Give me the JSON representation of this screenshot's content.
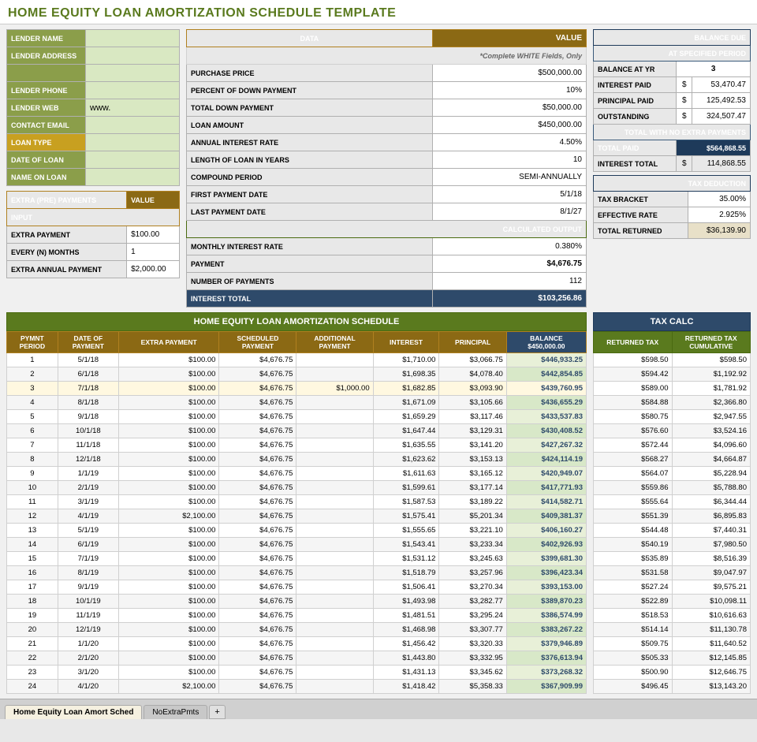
{
  "title": "HOME EQUITY LOAN AMORTIZATION SCHEDULE TEMPLATE",
  "lender": {
    "fields": [
      {
        "label": "LENDER NAME",
        "value": ""
      },
      {
        "label": "LENDER ADDRESS",
        "value": ""
      },
      {
        "label": "",
        "value": ""
      },
      {
        "label": "LENDER PHONE",
        "value": ""
      },
      {
        "label": "LENDER WEB",
        "value": "www."
      },
      {
        "label": "CONTACT EMAIL",
        "value": ""
      },
      {
        "label": "LOAN TYPE",
        "value": ""
      },
      {
        "label": "DATE OF LOAN",
        "value": ""
      },
      {
        "label": "NAME ON LOAN",
        "value": ""
      }
    ]
  },
  "extra_payments": {
    "header": "EXTRA (PRE) PAYMENTS",
    "value_col": "VALUE",
    "input_label": "INPUT",
    "fields": [
      {
        "label": "EXTRA PAYMENT",
        "value": "$100.00"
      },
      {
        "label": "EVERY (N) MONTHS",
        "value": "1"
      },
      {
        "label": "EXTRA ANNUAL PAYMENT",
        "value": "$2,000.00"
      }
    ]
  },
  "data_section": {
    "headers": [
      "DATA",
      "VALUE"
    ],
    "note": "*Complete WHITE Fields, Only",
    "rows": [
      {
        "label": "PURCHASE PRICE",
        "value": "$500,000.00"
      },
      {
        "label": "PERCENT OF DOWN PAYMENT",
        "value": "10%"
      },
      {
        "label": "TOTAL DOWN PAYMENT",
        "value": "$50,000.00"
      },
      {
        "label": "LOAN AMOUNT",
        "value": "$450,000.00"
      },
      {
        "label": "ANNUAL INTEREST RATE",
        "value": "4.50%"
      },
      {
        "label": "LENGTH OF LOAN IN YEARS",
        "value": "10"
      },
      {
        "label": "COMPOUND PERIOD",
        "value": "SEMI-ANNUALLY"
      },
      {
        "label": "FIRST PAYMENT DATE",
        "value": "5/1/18"
      },
      {
        "label": "LAST PAYMENT DATE",
        "value": "8/1/27"
      }
    ],
    "calc_header": "CALCULATED OUTPUT",
    "calc_rows": [
      {
        "label": "MONTHLY INTEREST RATE",
        "value": "0.380%"
      },
      {
        "label": "PAYMENT",
        "value": "$4,676.75"
      },
      {
        "label": "NUMBER OF PAYMENTS",
        "value": "112"
      },
      {
        "label": "INTEREST TOTAL",
        "value": "$103,256.86"
      }
    ]
  },
  "balance_due": {
    "header": "BALANCE DUE",
    "sub_header": "AT SPECIFIED PERIOD",
    "yr_label": "BALANCE AT YR",
    "yr_value": "3",
    "rows": [
      {
        "label": "INTEREST PAID",
        "symbol": "$",
        "value": "53,470.47"
      },
      {
        "label": "PRINCIPAL PAID",
        "symbol": "$",
        "value": "125,492.53"
      },
      {
        "label": "OUTSTANDING",
        "symbol": "$",
        "value": "324,507.47"
      }
    ],
    "total_header": "TOTAL WITH NO EXTRA PAYMENTS",
    "total_rows": [
      {
        "label": "TOTAL PAID",
        "value": "$564,868.55"
      },
      {
        "label": "INTEREST TOTAL",
        "symbol": "$",
        "value": "114,868.55"
      }
    ]
  },
  "tax_deduction": {
    "header": "TAX DEDUCTION",
    "rows": [
      {
        "label": "TAX BRACKET",
        "value": "35.00%"
      },
      {
        "label": "EFFECTIVE RATE",
        "value": "2.925%"
      },
      {
        "label": "TOTAL RETURNED",
        "value": "$36,139.90"
      }
    ]
  },
  "schedule": {
    "title": "HOME EQUITY LOAN AMORTIZATION SCHEDULE",
    "tax_calc_title": "TAX CALC",
    "col_headers": {
      "pymnt_period": "PYMNT PERIOD",
      "date_of_payment": "DATE OF PAYMENT",
      "extra_payment": "EXTRA PAYMENT",
      "scheduled_payment": "SCHEDULED PAYMENT",
      "additional_payment": "ADDITIONAL PAYMENT",
      "interest": "INTEREST",
      "principal": "PRINCIPAL",
      "balance": "BALANCE",
      "balance_sub": "$450,000.00",
      "returned_tax": "RETURNED TAX",
      "returned_tax_cumulative": "RETURNED TAX CUMULATIVE"
    },
    "rows": [
      {
        "period": 1,
        "date": "5/1/18",
        "extra": "$100.00",
        "scheduled": "$4,676.75",
        "additional": "",
        "interest": "$1,710.00",
        "principal": "$3,066.75",
        "balance": "$446,933.25",
        "ret_tax": "$598.50",
        "ret_cum": "$598.50"
      },
      {
        "period": 2,
        "date": "6/1/18",
        "extra": "$100.00",
        "scheduled": "$4,676.75",
        "additional": "",
        "interest": "$1,698.35",
        "principal": "$4,078.40",
        "balance": "$442,854.85",
        "ret_tax": "$594.42",
        "ret_cum": "$1,192.92"
      },
      {
        "period": 3,
        "date": "7/1/18",
        "extra": "$100.00",
        "scheduled": "$4,676.75",
        "additional": "$1,000.00",
        "interest": "$1,682.85",
        "principal": "$3,093.90",
        "balance": "$439,760.95",
        "ret_tax": "$589.00",
        "ret_cum": "$1,781.92"
      },
      {
        "period": 4,
        "date": "8/1/18",
        "extra": "$100.00",
        "scheduled": "$4,676.75",
        "additional": "",
        "interest": "$1,671.09",
        "principal": "$3,105.66",
        "balance": "$436,655.29",
        "ret_tax": "$584.88",
        "ret_cum": "$2,366.80"
      },
      {
        "period": 5,
        "date": "9/1/18",
        "extra": "$100.00",
        "scheduled": "$4,676.75",
        "additional": "",
        "interest": "$1,659.29",
        "principal": "$3,117.46",
        "balance": "$433,537.83",
        "ret_tax": "$580.75",
        "ret_cum": "$2,947.55"
      },
      {
        "period": 6,
        "date": "10/1/18",
        "extra": "$100.00",
        "scheduled": "$4,676.75",
        "additional": "",
        "interest": "$1,647.44",
        "principal": "$3,129.31",
        "balance": "$430,408.52",
        "ret_tax": "$576.60",
        "ret_cum": "$3,524.16"
      },
      {
        "period": 7,
        "date": "11/1/18",
        "extra": "$100.00",
        "scheduled": "$4,676.75",
        "additional": "",
        "interest": "$1,635.55",
        "principal": "$3,141.20",
        "balance": "$427,267.32",
        "ret_tax": "$572.44",
        "ret_cum": "$4,096.60"
      },
      {
        "period": 8,
        "date": "12/1/18",
        "extra": "$100.00",
        "scheduled": "$4,676.75",
        "additional": "",
        "interest": "$1,623.62",
        "principal": "$3,153.13",
        "balance": "$424,114.19",
        "ret_tax": "$568.27",
        "ret_cum": "$4,664.87"
      },
      {
        "period": 9,
        "date": "1/1/19",
        "extra": "$100.00",
        "scheduled": "$4,676.75",
        "additional": "",
        "interest": "$1,611.63",
        "principal": "$3,165.12",
        "balance": "$420,949.07",
        "ret_tax": "$564.07",
        "ret_cum": "$5,228.94"
      },
      {
        "period": 10,
        "date": "2/1/19",
        "extra": "$100.00",
        "scheduled": "$4,676.75",
        "additional": "",
        "interest": "$1,599.61",
        "principal": "$3,177.14",
        "balance": "$417,771.93",
        "ret_tax": "$559.86",
        "ret_cum": "$5,788.80"
      },
      {
        "period": 11,
        "date": "3/1/19",
        "extra": "$100.00",
        "scheduled": "$4,676.75",
        "additional": "",
        "interest": "$1,587.53",
        "principal": "$3,189.22",
        "balance": "$414,582.71",
        "ret_tax": "$555.64",
        "ret_cum": "$6,344.44"
      },
      {
        "period": 12,
        "date": "4/1/19",
        "extra": "$2,100.00",
        "scheduled": "$4,676.75",
        "additional": "",
        "interest": "$1,575.41",
        "principal": "$5,201.34",
        "balance": "$409,381.37",
        "ret_tax": "$551.39",
        "ret_cum": "$6,895.83"
      },
      {
        "period": 13,
        "date": "5/1/19",
        "extra": "$100.00",
        "scheduled": "$4,676.75",
        "additional": "",
        "interest": "$1,555.65",
        "principal": "$3,221.10",
        "balance": "$406,160.27",
        "ret_tax": "$544.48",
        "ret_cum": "$7,440.31"
      },
      {
        "period": 14,
        "date": "6/1/19",
        "extra": "$100.00",
        "scheduled": "$4,676.75",
        "additional": "",
        "interest": "$1,543.41",
        "principal": "$3,233.34",
        "balance": "$402,926.93",
        "ret_tax": "$540.19",
        "ret_cum": "$7,980.50"
      },
      {
        "period": 15,
        "date": "7/1/19",
        "extra": "$100.00",
        "scheduled": "$4,676.75",
        "additional": "",
        "interest": "$1,531.12",
        "principal": "$3,245.63",
        "balance": "$399,681.30",
        "ret_tax": "$535.89",
        "ret_cum": "$8,516.39"
      },
      {
        "period": 16,
        "date": "8/1/19",
        "extra": "$100.00",
        "scheduled": "$4,676.75",
        "additional": "",
        "interest": "$1,518.79",
        "principal": "$3,257.96",
        "balance": "$396,423.34",
        "ret_tax": "$531.58",
        "ret_cum": "$9,047.97"
      },
      {
        "period": 17,
        "date": "9/1/19",
        "extra": "$100.00",
        "scheduled": "$4,676.75",
        "additional": "",
        "interest": "$1,506.41",
        "principal": "$3,270.34",
        "balance": "$393,153.00",
        "ret_tax": "$527.24",
        "ret_cum": "$9,575.21"
      },
      {
        "period": 18,
        "date": "10/1/19",
        "extra": "$100.00",
        "scheduled": "$4,676.75",
        "additional": "",
        "interest": "$1,493.98",
        "principal": "$3,282.77",
        "balance": "$389,870.23",
        "ret_tax": "$522.89",
        "ret_cum": "$10,098.11"
      },
      {
        "period": 19,
        "date": "11/1/19",
        "extra": "$100.00",
        "scheduled": "$4,676.75",
        "additional": "",
        "interest": "$1,481.51",
        "principal": "$3,295.24",
        "balance": "$386,574.99",
        "ret_tax": "$518.53",
        "ret_cum": "$10,616.63"
      },
      {
        "period": 20,
        "date": "12/1/19",
        "extra": "$100.00",
        "scheduled": "$4,676.75",
        "additional": "",
        "interest": "$1,468.98",
        "principal": "$3,307.77",
        "balance": "$383,267.22",
        "ret_tax": "$514.14",
        "ret_cum": "$11,130.78"
      },
      {
        "period": 21,
        "date": "1/1/20",
        "extra": "$100.00",
        "scheduled": "$4,676.75",
        "additional": "",
        "interest": "$1,456.42",
        "principal": "$3,320.33",
        "balance": "$379,946.89",
        "ret_tax": "$509.75",
        "ret_cum": "$11,640.52"
      },
      {
        "period": 22,
        "date": "2/1/20",
        "extra": "$100.00",
        "scheduled": "$4,676.75",
        "additional": "",
        "interest": "$1,443.80",
        "principal": "$3,332.95",
        "balance": "$376,613.94",
        "ret_tax": "$505.33",
        "ret_cum": "$12,145.85"
      },
      {
        "period": 23,
        "date": "3/1/20",
        "extra": "$100.00",
        "scheduled": "$4,676.75",
        "additional": "",
        "interest": "$1,431.13",
        "principal": "$3,345.62",
        "balance": "$373,268.32",
        "ret_tax": "$500.90",
        "ret_cum": "$12,646.75"
      },
      {
        "period": 24,
        "date": "4/1/20",
        "extra": "$2,100.00",
        "scheduled": "$4,676.75",
        "additional": "",
        "interest": "$1,418.42",
        "principal": "$5,358.33",
        "balance": "$367,909.99",
        "ret_tax": "$496.45",
        "ret_cum": "$13,143.20"
      }
    ]
  },
  "tabs": [
    {
      "label": "Home Equity Loan Amort Sched",
      "active": true
    },
    {
      "label": "NoExtraPmts",
      "active": false
    }
  ]
}
